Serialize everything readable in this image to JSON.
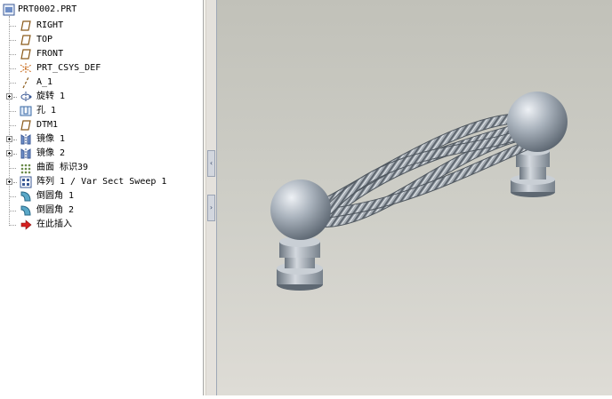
{
  "model_tree": {
    "root": "PRT0002.PRT",
    "items": [
      {
        "label": "RIGHT",
        "icon": "datum-plane-icon",
        "expandable": false
      },
      {
        "label": "TOP",
        "icon": "datum-plane-icon",
        "expandable": false
      },
      {
        "label": "FRONT",
        "icon": "datum-plane-icon",
        "expandable": false
      },
      {
        "label": "PRT_CSYS_DEF",
        "icon": "coordinate-system-icon",
        "expandable": false
      },
      {
        "label": "A_1",
        "icon": "datum-axis-icon",
        "expandable": false
      },
      {
        "label": "旋转 1",
        "icon": "revolve-icon",
        "expandable": true
      },
      {
        "label": "孔 1",
        "icon": "hole-icon",
        "expandable": false
      },
      {
        "label": "DTM1",
        "icon": "datum-plane-icon",
        "expandable": false
      },
      {
        "label": "镜像 1",
        "icon": "mirror-icon",
        "expandable": true
      },
      {
        "label": "镜像 2",
        "icon": "mirror-icon",
        "expandable": true
      },
      {
        "label": "曲面 标识39",
        "icon": "surface-icon",
        "expandable": false
      },
      {
        "label": "阵列 1 / Var Sect Sweep 1",
        "icon": "pattern-icon",
        "expandable": true
      },
      {
        "label": "倒圆角 1",
        "icon": "round-icon",
        "expandable": false
      },
      {
        "label": "倒圆角 2",
        "icon": "round-icon",
        "expandable": false
      },
      {
        "label": "在此插入",
        "icon": "insert-here-arrow-icon",
        "expandable": false
      }
    ]
  },
  "splitter": {
    "collapse_arrow": "‹",
    "expand_arrow": "›"
  },
  "viewport": {
    "model": "twisted-rope-handle-with-ball-ends"
  }
}
